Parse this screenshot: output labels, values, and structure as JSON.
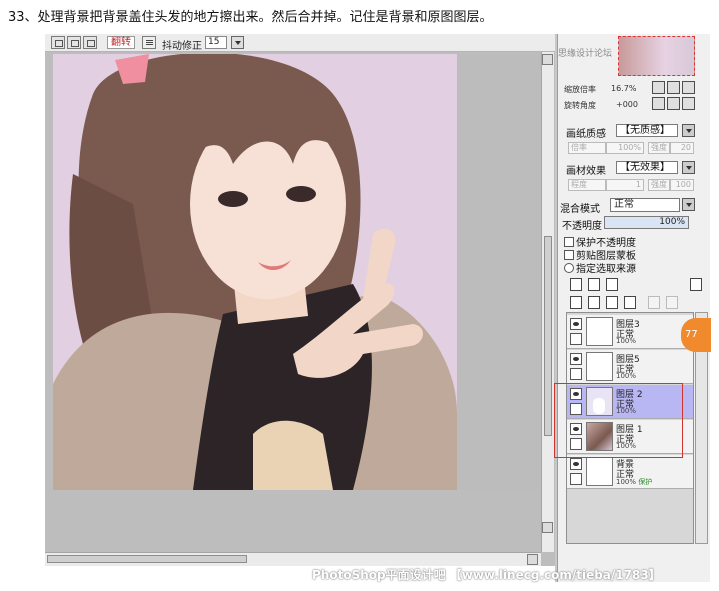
{
  "heading": "33、处理背景把背景盖住头发的地方擦出来。然后合并掉。记住是背景和原图图层。",
  "toolbar": {
    "flip_label": "翻转",
    "stabilizer_label": "抖动修正",
    "stabilizer_value": "15"
  },
  "panel": {
    "forum_mark": "思缘设计论坛",
    "zoom_label": "缩放倍率",
    "zoom_value": "16.7%",
    "rotate_label": "旋转角度",
    "rotate_value": "+000",
    "paper_texture_label": "画纸质感",
    "paper_texture_value": "【无质感】",
    "paper_rate_label": "倍率",
    "paper_rate_value": "100%",
    "paper_strength_label": "强度",
    "paper_strength_value": "20",
    "material_label": "画材效果",
    "material_value": "【无效果】",
    "material_width_label": "程度",
    "material_width_value": "1",
    "material_strength_label": "强度",
    "material_strength_value": "100",
    "blend_label": "混合模式",
    "blend_value": "正常",
    "opacity_label": "不透明度",
    "opacity_value": "100%",
    "checkboxes": [
      "保护不透明度",
      "剪贴图层蒙板",
      "指定选取来源"
    ]
  },
  "layers": [
    {
      "name": "图层3",
      "mode": "正常",
      "opacity": "100%",
      "selected": false,
      "thumb": "blank"
    },
    {
      "name": "图层5",
      "mode": "正常",
      "opacity": "100%",
      "selected": false,
      "thumb": "blank"
    },
    {
      "name": "图层 2",
      "mode": "正常",
      "opacity": "100%",
      "selected": true,
      "thumb": "white-shape"
    },
    {
      "name": "图层 1",
      "mode": "正常",
      "opacity": "100%",
      "selected": false,
      "thumb": "photo"
    },
    {
      "name": "背景",
      "mode": "正常",
      "opacity": "100%",
      "extra": "保护",
      "selected": false,
      "thumb": "blank"
    }
  ],
  "badge": "77",
  "watermark": "PhotoShop平面设计吧 【www.linecg.com/tieba/1783】",
  "colors": {
    "photo_bg": "#e2cfe1",
    "selected_layer": "#b9b6f4",
    "highlight_box": "#d0342c",
    "badge": "#f08a2c"
  }
}
